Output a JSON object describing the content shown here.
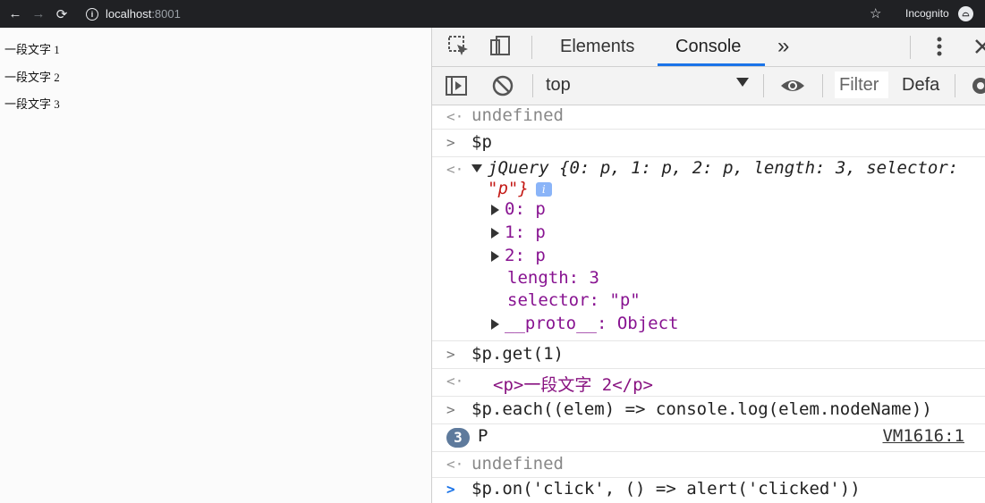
{
  "browser": {
    "url_host": "localhost",
    "url_port": ":8001",
    "incognito_label": "Incognito"
  },
  "page": {
    "paragraphs": [
      "一段文字 1",
      "一段文字 2",
      "一段文字 3"
    ]
  },
  "devtools": {
    "tabs": [
      "Elements",
      "Console"
    ],
    "more_tabs": "»",
    "context": "top",
    "filter_placeholder": "Filter",
    "levels_label": "Defa"
  },
  "console": {
    "r1": "undefined",
    "r2_input": "$p",
    "jq_head": "jQuery {0: p, 1: p, 2: p, length: 3, selector:",
    "jq_selector": "\"p\"}",
    "info": "i",
    "items": [
      "0: p",
      "1: p",
      "2: p"
    ],
    "length_line": "length: 3",
    "selector_line": "selector: \"p\"",
    "proto_line": "__proto__: Object",
    "get_input": "$p.get(1)",
    "get_output": "<p>一段文字 2</p>",
    "each_input": "$p.each((elem) => console.log(elem.nodeName))",
    "log_count": "3",
    "log_value": "P",
    "log_source": "VM1616:1",
    "r_undef": "undefined",
    "on_input": "$p.on('click', () => alert('clicked'))"
  }
}
